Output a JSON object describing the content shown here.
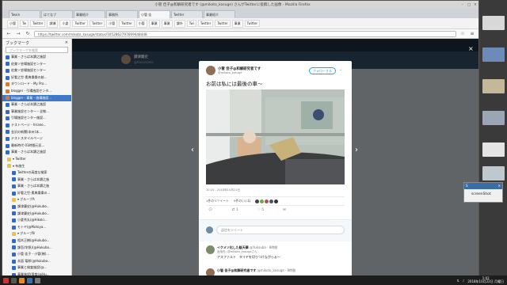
{
  "window": {
    "title": "小管 佳子@和解研究者です (@mikoto_kosuge) さんがTwitterに投稿した画像 - Mozilla Firefox"
  },
  "tabs": [
    "Twain",
    "はてなブ",
    "事業紹介",
    "事務所",
    "小管 佳",
    "Twitter",
    "事業紹介"
  ],
  "bookmarks": [
    "小管",
    "Tw",
    "Twitter",
    "課瀬",
    "小倉",
    "Twitter",
    "Twitter",
    "小管",
    "Twitter",
    "小管",
    "事業",
    "事業",
    "課外",
    "Twi",
    "Twitter",
    "Twitter",
    "事業",
    "Twitter"
  ],
  "url": "https://twitter.com/mikoto_kosuge/status/1052862797669448448",
  "sidebar": {
    "title": "ブックマーク",
    "close": "×",
    "search_placeholder": "ブックマークを検索",
    "items": [
      {
        "label": "事業・さらば本讀之施設",
        "color": "#2c6bd6"
      },
      {
        "label": "佐美ソ芸場施設センター",
        "color": "#2c6bd6"
      },
      {
        "label": "佐美ソ芸場施設センター",
        "color": "#2c6bd6"
      },
      {
        "label": "好看之世-素典樂樂の創...",
        "color": "#2c6bd6"
      },
      {
        "label": "ダウンロード - My Pro...",
        "color": "#e07a1f"
      },
      {
        "label": "blogger - 引場施設センタ...",
        "color": "#e07a1f"
      },
      {
        "label": "blogger - 事業・施場施設...",
        "color": "#e07a1f",
        "selected": true
      },
      {
        "label": "事業・さらば本讀之施設",
        "color": "#2c6bd6"
      },
      {
        "label": "事業施設センター・全線...",
        "color": "#2c6bd6"
      },
      {
        "label": "引場施設センター施設...",
        "color": "#2c6bd6"
      },
      {
        "label": "テストページ - hirano...",
        "color": "#2c6bd6"
      },
      {
        "label": "金沢の新聞(本州)本...",
        "color": "#2c6bd6"
      },
      {
        "label": "テストスタイルページ",
        "color": "#2c6bd6"
      },
      {
        "label": "最新時代-01時間元気...",
        "color": "#2c6bd6"
      },
      {
        "label": "事業・さらば本讀之施設",
        "color": "#2c6bd6"
      },
      {
        "label": "▾ Twitter",
        "color": "#f0c040"
      },
      {
        "label": "▾ 布施生",
        "color": "#f0c040"
      },
      {
        "label": "Twitterの高度な検索",
        "color": "#2c6bd6"
      },
      {
        "label": "事業・さらば本讀之施",
        "color": "#2c6bd6"
      },
      {
        "label": "事業・さらば本讀之施",
        "color": "#2c6bd6"
      },
      {
        "label": "好看之世-素典樂樂の...",
        "color": "#2c6bd6"
      },
      {
        "label": "▾ グループA",
        "color": "#f0c040"
      },
      {
        "label": "課津蘭史(@Hukubo...",
        "color": "#2c6bd6"
      },
      {
        "label": "課津蘭史(@Hukubo...",
        "color": "#2c6bd6"
      },
      {
        "label": "小倉秀丸(@Hikoki...",
        "color": "#2c6bd6"
      },
      {
        "label": "モトヤ(@Motoya...",
        "color": "#2c6bd6"
      },
      {
        "label": "▾ グループB",
        "color": "#f0c040"
      },
      {
        "label": "相木正樹(@Hukubo...",
        "color": "#2c6bd6"
      },
      {
        "label": "課吾(竿帆)(@Hukubo...",
        "color": "#2c6bd6"
      },
      {
        "label": "小管 佳子 - 小管(樹)...",
        "color": "#2c6bd6"
      },
      {
        "label": "本語 竜郎(@Hukubo...",
        "color": "#2c6bd6"
      },
      {
        "label": "事業と検査施設(@...",
        "color": "#2c6bd6"
      },
      {
        "label": "事業施設(保育(@Hu...",
        "color": "#2c6bd6"
      },
      {
        "label": "事業・さらば本讀之施",
        "color": "#2c6bd6"
      }
    ]
  },
  "twitter": {
    "profile_name": "課津蘭史",
    "profile_handle": "@Kasonome",
    "tweet": {
      "author_name": "小管 佳子@和解研究者です",
      "author_handle": "@mikoto_kosuge",
      "follow_label": "フォローする",
      "text": "お前は私には最後の車〜",
      "timestamp": "10:20 - 2018年10月21日",
      "retweets": "1件のリツイート",
      "likes": "5件のいいね",
      "reply_icon": "reply-icon",
      "retweet_count": "1",
      "like_count": "5",
      "reply_placeholder": "返信をツイート"
    },
    "replies": [
      {
        "name": "イクメソ化した駄天華",
        "handle": "@Yukouba · 8時間",
        "to": "返信先: @mikoto_kosugeさん",
        "body": "アスファルト　タイヤを切りつけながらぁ〜"
      },
      {
        "name": "小管 佳子@和解研究者です",
        "handle": "@mikoto_kosuge · 8時間",
        "to": "",
        "body": ""
      }
    ]
  },
  "popup": {
    "title": "S",
    "label": "screenShot"
  },
  "taskbar": {
    "clock_time": "1:02",
    "clock_date": "2018年10月22日 月曜日"
  },
  "colors": {
    "twitter_blue": "#1da1f2",
    "selection": "#3e78c9"
  }
}
